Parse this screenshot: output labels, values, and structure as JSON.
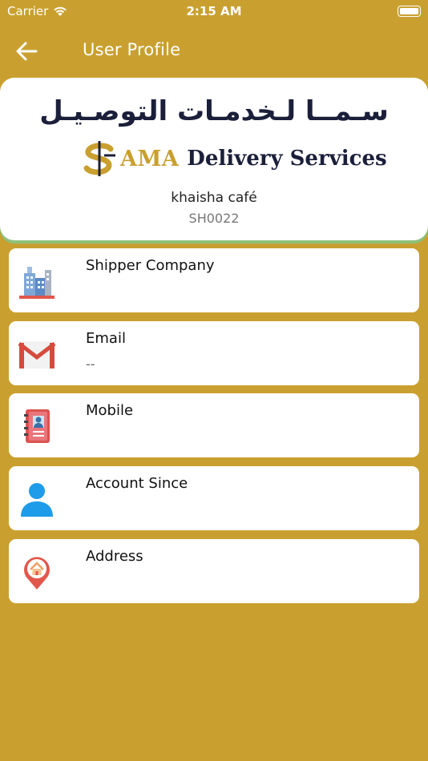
{
  "status_bar": {
    "carrier": "Carrier",
    "time": "2:15 AM"
  },
  "nav": {
    "title": "User Profile"
  },
  "header": {
    "logo_arabic": "سـمــا لـخدمـات التوصـيـل",
    "logo_ama": "AMA",
    "logo_delivery": "Delivery Services",
    "shop_name": "khaisha café",
    "shop_code": "SH0022"
  },
  "fields": [
    {
      "label": "Shipper Company",
      "value": "",
      "icon": "office-building-icon"
    },
    {
      "label": "Email",
      "value": "--",
      "icon": "gmail-icon"
    },
    {
      "label": "Mobile",
      "value": "",
      "icon": "contact-book-icon"
    },
    {
      "label": "Account Since",
      "value": "",
      "icon": "user-icon"
    },
    {
      "label": "Address",
      "value": "",
      "icon": "map-pin-home-icon"
    }
  ],
  "colors": {
    "background": "#C9A030",
    "accent_green": "#8EC07A",
    "navy": "#1B1F3A"
  }
}
